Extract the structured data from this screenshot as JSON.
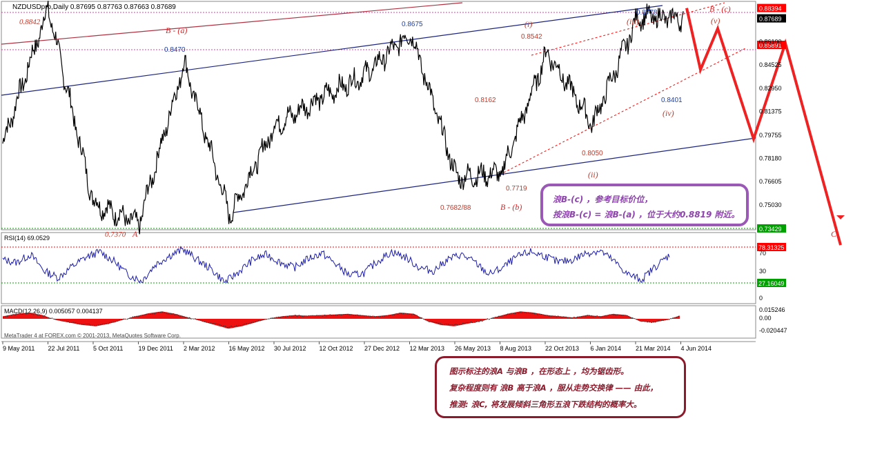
{
  "chart_data": [
    {
      "type": "line",
      "title": "NZDUSDpro,Daily",
      "ohlc_header": "0.87695 0.87763 0.87663 0.87689",
      "x_tick_labels": [
        "9 May 2011",
        "22 Jul 2011",
        "5 Oct 2011",
        "19 Dec 2011",
        "2 Mar 2012",
        "16 May 2012",
        "30 Jul 2012",
        "12 Oct 2012",
        "27 Dec 2012",
        "12 Mar 2013",
        "26 May 2013",
        "8 Aug 2013",
        "22 Oct 2013",
        "6 Jan 2014",
        "21 Mar 2014",
        "4 Jun 2014"
      ],
      "y_tick_labels": [
        "0.86100",
        "0.84525",
        "0.82950",
        "0.81375",
        "0.79755",
        "0.78180",
        "0.76605",
        "0.75030"
      ],
      "ylim": [
        0.7343,
        0.8875
      ],
      "price_tags": [
        {
          "label": "0.88394",
          "value": 0.88394,
          "color": "#ff0000"
        },
        {
          "label": "0.87689",
          "value": 0.87689,
          "color": "#000000"
        },
        {
          "label": "0.85891",
          "value": 0.85891,
          "color": "#ff0000"
        },
        {
          "label": "0.73429",
          "value": 0.73429,
          "color": "#00a000"
        }
      ],
      "series": [
        {
          "x": [
            "9 May 2011",
            "22 Jul 2011",
            "5 Oct 2011",
            "19 Dec 2011",
            "2 Mar 2012",
            "16 May 2012",
            "30 Jul 2012",
            "12 Oct 2012",
            "27 Dec 2012",
            "12 Mar 2013",
            "26 May 2013",
            "8 Aug 2013",
            "22 Oct 2013",
            "6 Jan 2014",
            "21 Mar 2014",
            "4 Jun 2014"
          ],
          "values": [
            0.792,
            0.8842,
            0.752,
            0.737,
            0.847,
            0.743,
            0.804,
            0.823,
            0.839,
            0.8675,
            0.769,
            0.7719,
            0.8542,
            0.805,
            0.8778,
            0.8769
          ]
        }
      ],
      "projection_path": [
        0.8839,
        0.842,
        0.87,
        0.795,
        0.86,
        0.723
      ],
      "annotations": [
        {
          "text": "0.8842",
          "value": 0.8842,
          "color": "#c0392b"
        },
        {
          "text": "B - (a)",
          "color": "#d62728"
        },
        {
          "text": "0.8470",
          "value": 0.847,
          "color": "#1f3fa0"
        },
        {
          "text": "0.8675",
          "value": 0.8675,
          "color": "#1f3fa0"
        },
        {
          "text": "(i)",
          "color": "#c0392b"
        },
        {
          "text": "0.8542",
          "value": 0.8542,
          "color": "#c0392b"
        },
        {
          "text": "0.8778",
          "value": 0.8778,
          "color": "#1f3fa0"
        },
        {
          "text": "(iii)",
          "color": "#c0392b"
        },
        {
          "text": "B - (c)",
          "color": "#d62728"
        },
        {
          "text": "(v)",
          "color": "#c0392b"
        },
        {
          "text": "0.8162",
          "value": 0.8162,
          "color": "#c0392b"
        },
        {
          "text": "0.8401",
          "value": 0.8401,
          "color": "#1f3fa0"
        },
        {
          "text": "(iv)",
          "color": "#c0392b"
        },
        {
          "text": "0.8050",
          "value": 0.805,
          "color": "#c0392b"
        },
        {
          "text": "(ii)",
          "color": "#c0392b"
        },
        {
          "text": "0.7719",
          "value": 0.7719,
          "color": "#c0392b"
        },
        {
          "text": "0.7682/88",
          "color": "#c0392b"
        },
        {
          "text": "B - (b)",
          "color": "#d62728"
        },
        {
          "text": "0.7370",
          "value": 0.737,
          "color": "#c0392b"
        },
        {
          "text": "A",
          "color": "#d62728"
        },
        {
          "text": "C",
          "color": "#d62728"
        }
      ]
    },
    {
      "type": "line",
      "title": "RSI(14) 69.0529",
      "ylim": [
        0,
        100
      ],
      "y_tick_labels": [
        "70",
        "30",
        "0"
      ],
      "levels": [
        {
          "label": "78.31325",
          "value": 78.31325,
          "color": "#ff0000"
        },
        {
          "label": "27.16049",
          "value": 27.16049,
          "color": "#00a000"
        }
      ],
      "series": [
        {
          "values": [
            62,
            58,
            70,
            45,
            35,
            52,
            66,
            74,
            60,
            40,
            30,
            55,
            68,
            78,
            62,
            48,
            28,
            44,
            62,
            70,
            58,
            50,
            64,
            72,
            55,
            38,
            42,
            60,
            74,
            66,
            50,
            45,
            62,
            70,
            58,
            40,
            50,
            66,
            74,
            68,
            58,
            62,
            72,
            76,
            60,
            40,
            32,
            52,
            69
          ]
        }
      ]
    },
    {
      "type": "area",
      "title": "MACD(12,26,9) 0.005057 0.004137",
      "y_tick_labels": [
        "0.015246",
        "0.00",
        "-0.020447"
      ],
      "series": [
        {
          "values": [
            0.004,
            0.008,
            0.01,
            0.006,
            -0.002,
            -0.006,
            -0.01,
            -0.012,
            -0.008,
            -0.002,
            0.004,
            0.009,
            0.012,
            0.008,
            0.002,
            -0.004,
            -0.01,
            -0.016,
            -0.012,
            -0.006,
            0.0,
            0.004,
            0.006,
            0.005,
            0.006,
            0.007,
            0.008,
            0.006,
            0.004,
            0.006,
            0.01,
            0.008,
            -0.004,
            -0.01,
            -0.012,
            -0.008,
            -0.004,
            0.002,
            0.008,
            0.012,
            0.01,
            0.006,
            0.004,
            0.002,
            0.006,
            0.004,
            0.008,
            0.006,
            -0.004,
            -0.006,
            -0.002,
            0.005
          ]
        }
      ]
    }
  ],
  "footer": "MetaTrader 4 at FOREX.com © 2001-2013, MetaQuotes Software Corp.",
  "note1": {
    "line1": "浪B-(c) ，参考目标价位，",
    "line2": "按浪B-(c) = 浪B-(a) ，位于大约0.8819 附近。"
  },
  "note2": {
    "line1": "图示标注的浪A 与浪B ，在形态上 ，均为锯齿形。",
    "line2": "复杂程度则有 浪B 高于浪A ，服从走势交换律 —— 由此，",
    "line3": "推测: 浪C, 将发展倾斜三角形五浪下跌结构的概率大。"
  }
}
